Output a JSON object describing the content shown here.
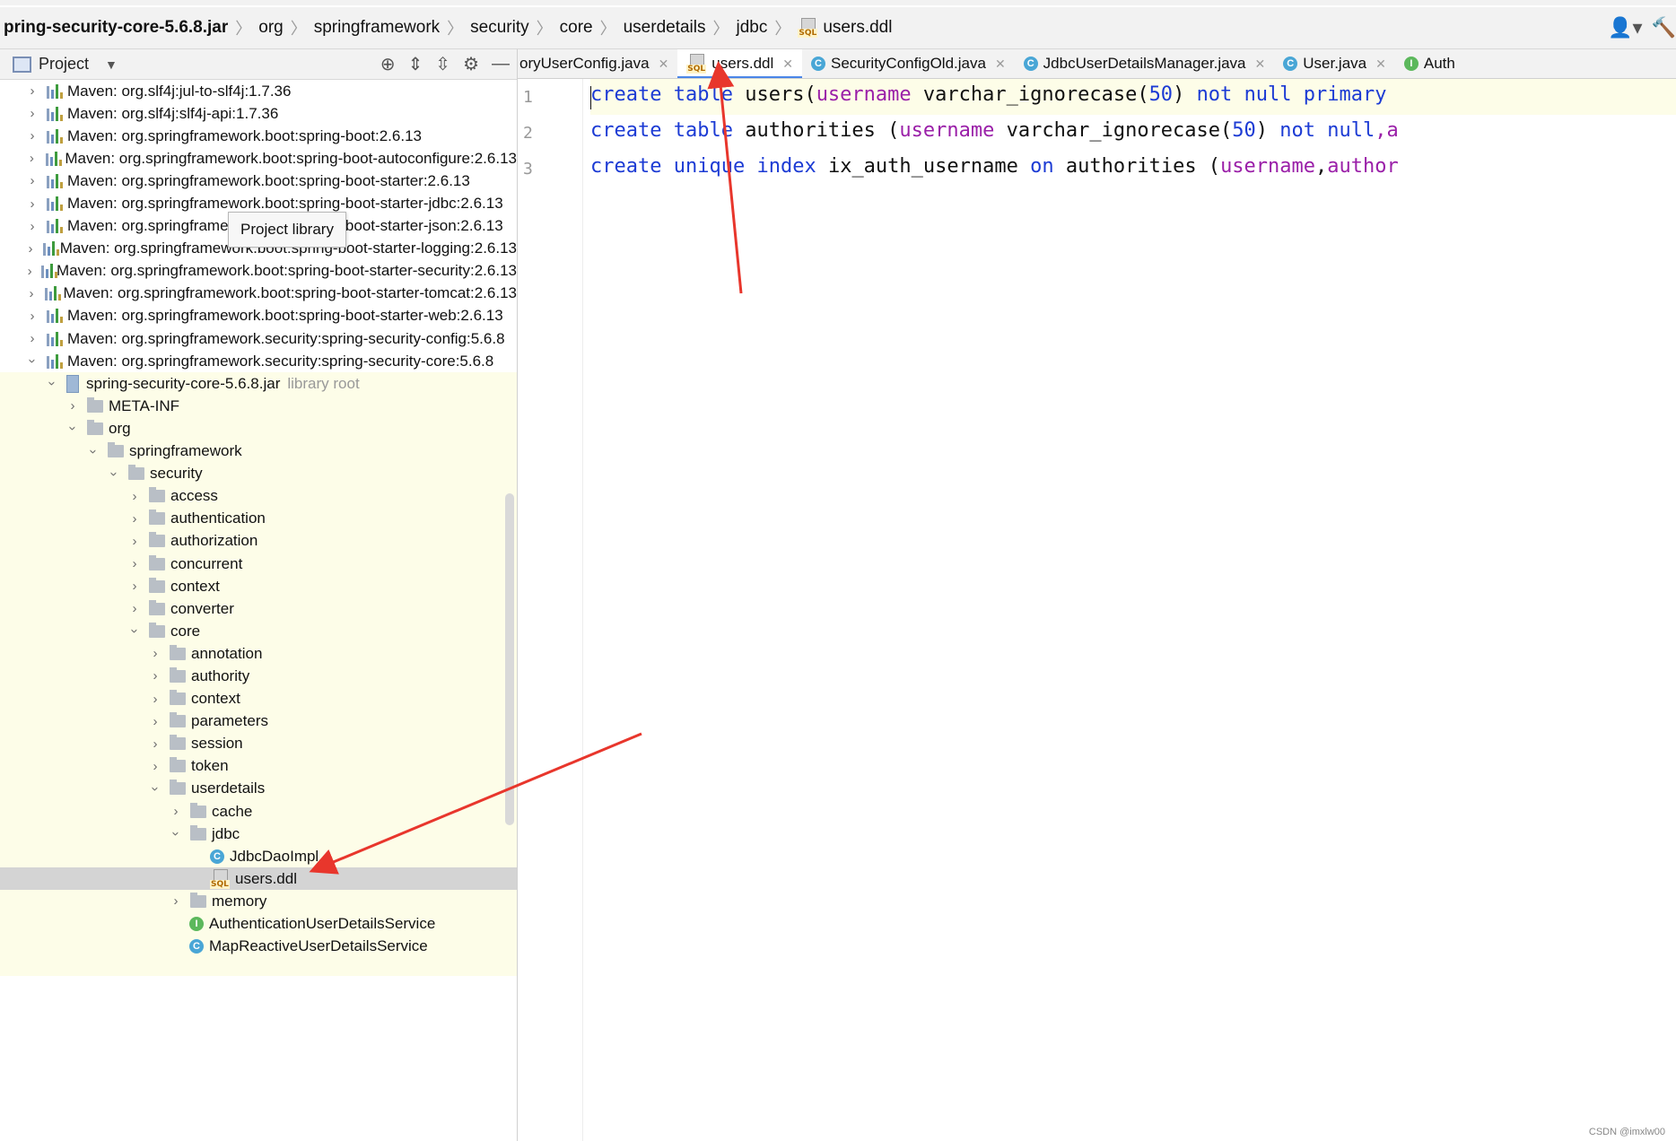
{
  "breadcrumb": {
    "items": [
      "pring-security-core-5.6.8.jar",
      "org",
      "springframework",
      "security",
      "core",
      "userdetails",
      "jdbc"
    ],
    "file": "users.ddl",
    "file_icon": "sql-file-icon"
  },
  "project_panel": {
    "title": "Project",
    "tooltip": "Project library",
    "tree": [
      {
        "label": "Maven: org.slf4j:jul-to-slf4j:1.7.36"
      },
      {
        "label": "Maven: org.slf4j:slf4j-api:1.7.36"
      },
      {
        "label": "Maven: org.springframework.boot:spring-boot:2.6.13"
      },
      {
        "label": "Maven: org.springframework.boot:spring-boot-autoconfigure:2.6.13"
      },
      {
        "label": "Maven: org.springframework.boot:spring-boot-starter:2.6.13"
      },
      {
        "label": "Maven: org.springframework.boot:spring-boot-starter-jdbc:2.6.13"
      },
      {
        "label": "Maven: org.springframework.boot:spring-boot-starter-json:2.6.13"
      },
      {
        "label": "Maven: org.springframework.boot:spring-boot-starter-logging:2.6.13"
      },
      {
        "label": "Maven: org.springframework.boot:spring-boot-starter-security:2.6.13"
      },
      {
        "label": "Maven: org.springframework.boot:spring-boot-starter-tomcat:2.6.13"
      },
      {
        "label": "Maven: org.springframework.boot:spring-boot-starter-web:2.6.13"
      },
      {
        "label": "Maven: org.springframework.security:spring-security-config:5.6.8"
      },
      {
        "label": "Maven: org.springframework.security:spring-security-core:5.6.8"
      },
      {
        "label": "spring-security-core-5.6.8.jar",
        "note": "library root"
      },
      {
        "label": "META-INF"
      },
      {
        "label": "org"
      },
      {
        "label": "springframework"
      },
      {
        "label": "security"
      },
      {
        "label": "access"
      },
      {
        "label": "authentication"
      },
      {
        "label": "authorization"
      },
      {
        "label": "concurrent"
      },
      {
        "label": "context"
      },
      {
        "label": "converter"
      },
      {
        "label": "core"
      },
      {
        "label": "annotation"
      },
      {
        "label": "authority"
      },
      {
        "label": "context"
      },
      {
        "label": "parameters"
      },
      {
        "label": "session"
      },
      {
        "label": "token"
      },
      {
        "label": "userdetails"
      },
      {
        "label": "cache"
      },
      {
        "label": "jdbc"
      },
      {
        "label": "JdbcDaoImpl"
      },
      {
        "label": "users.ddl"
      },
      {
        "label": "memory"
      },
      {
        "label": "AuthenticationUserDetailsService"
      },
      {
        "label": "MapReactiveUserDetailsService"
      }
    ]
  },
  "editor": {
    "tabs": [
      {
        "label": "oryUserConfig.java",
        "icon": "close"
      },
      {
        "label": "users.ddl",
        "icon": "sql-file-icon",
        "active": true
      },
      {
        "label": "SecurityConfigOld.java",
        "icon": "class-icon"
      },
      {
        "label": "JdbcUserDetailsManager.java",
        "icon": "class-icon"
      },
      {
        "label": "User.java",
        "icon": "class-icon"
      },
      {
        "label": "Auth",
        "icon": "interface-icon"
      }
    ],
    "line_numbers": [
      "1",
      "2",
      "3"
    ],
    "lines": [
      [
        "create",
        " ",
        "table",
        " users(",
        "username",
        " varchar_ignorecase(",
        "50",
        ") ",
        "not",
        " ",
        "null",
        " ",
        "primary"
      ],
      [
        "create",
        " ",
        "table",
        " authorities (",
        "username",
        " varchar_ignorecase(",
        "50",
        ") ",
        "not",
        " ",
        "null",
        ",a"
      ],
      [
        "create",
        " ",
        "unique",
        " ",
        "index",
        " ix_auth_username ",
        "on",
        " authorities (",
        "username",
        ",",
        "author"
      ]
    ]
  },
  "watermark": "CSDN @imxlw00"
}
